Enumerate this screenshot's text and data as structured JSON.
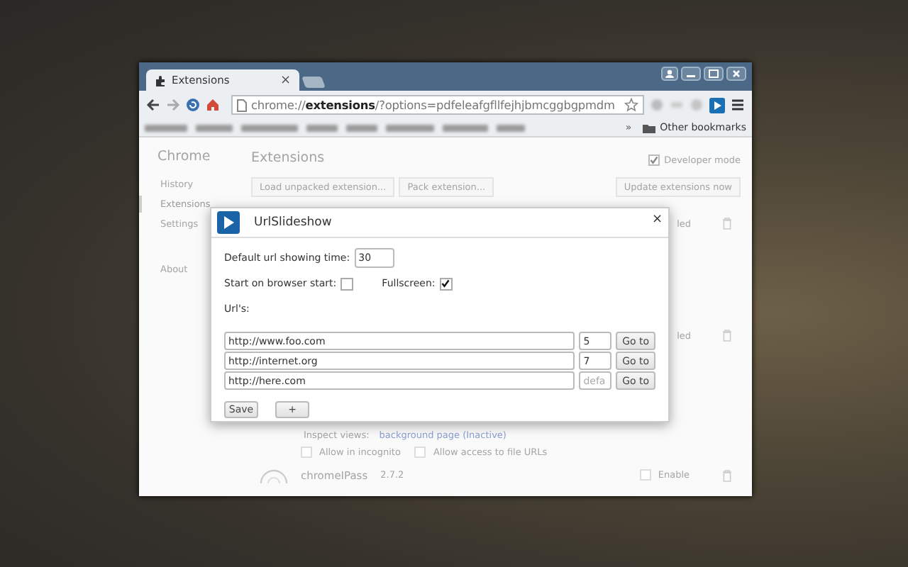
{
  "window": {
    "tab": {
      "title": "Extensions",
      "close": "×",
      "selected": true
    },
    "address": "chrome://**extensions**/?options=pdfeleafgfllfejhjbmcggbgpmdm",
    "bookmarks": {
      "overflow": "»",
      "other": "Other bookmarks"
    }
  },
  "page": {
    "brand": "Chrome",
    "nav": [
      {
        "label": "History",
        "selected": false
      },
      {
        "label": "Extensions",
        "selected": true
      },
      {
        "label": "Settings",
        "selected": false
      },
      {
        "label": "About",
        "selected": false
      }
    ],
    "title": "Extensions",
    "developer_mode": {
      "label": "Developer mode",
      "checked": true
    },
    "buttons": [
      "Load unpacked extension...",
      "Pack extension..."
    ],
    "update_button": "Update extensions now",
    "side_status": [
      "led",
      "led"
    ],
    "inspect": {
      "label": "Inspect views:",
      "link": "background page (Inactive)"
    },
    "options": [
      {
        "label": "Allow in incognito",
        "checked": false
      },
      {
        "label": "Allow access to file URLs",
        "checked": false
      }
    ],
    "extension": {
      "name": "chromeIPass",
      "version": "2.7.2",
      "enable": {
        "label": "Enable",
        "checked": false
      }
    }
  },
  "dialog": {
    "title": "UrlSlideshow",
    "close": "×",
    "time_label": "Default url showing time:",
    "time_value": "30",
    "start_label": "Start on browser start:",
    "start_checked": false,
    "fullscreen_label": "Fullscreen:",
    "fullscreen_checked": true,
    "urls_label": "Url's:",
    "urls": [
      {
        "url": "http://www.foo.com",
        "time": "5",
        "button": "Go to"
      },
      {
        "url": "http://internet.org",
        "time": "7",
        "button": "Go to"
      },
      {
        "url": "http://here.com",
        "placeholder": "defa",
        "button": "Go to"
      }
    ],
    "save": "Save",
    "add": "+"
  }
}
